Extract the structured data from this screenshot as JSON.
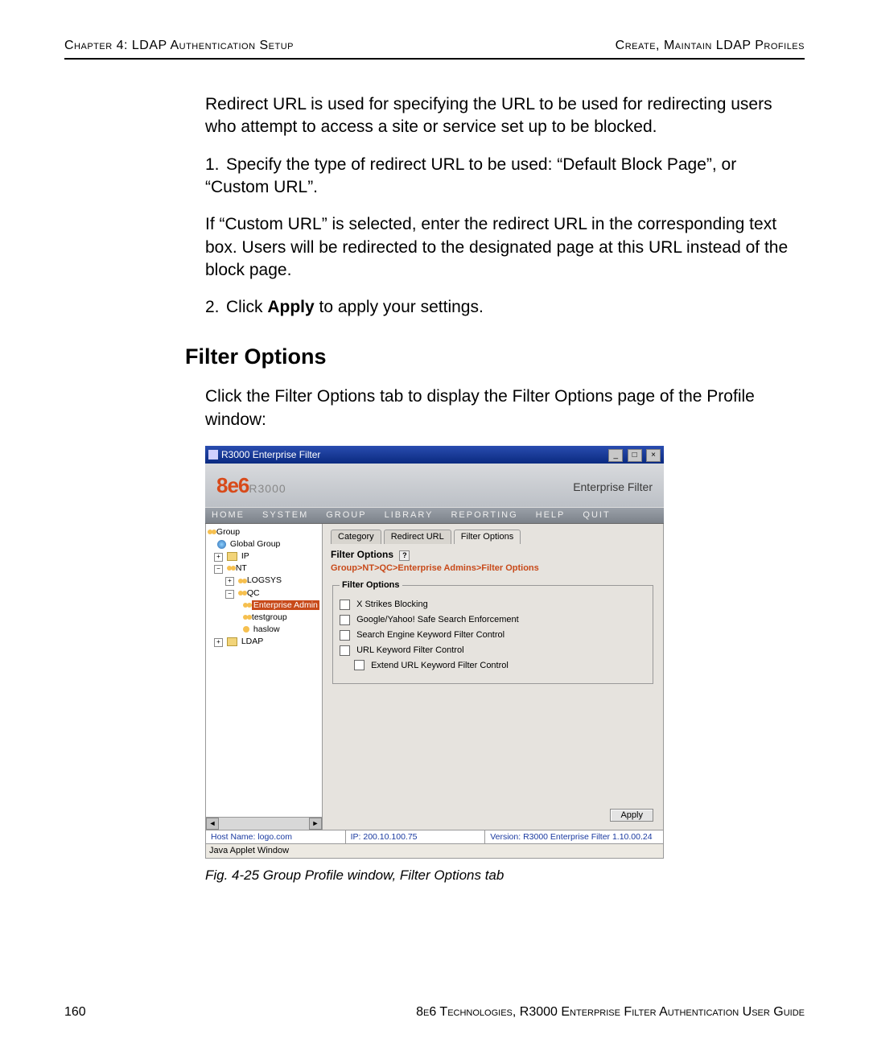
{
  "header": {
    "left": "Chapter 4: LDAP Authentication Setup",
    "right": "Create, Maintain LDAP Profiles"
  },
  "body": {
    "intro": "Redirect URL is used for specifying the URL to be used for redirecting users who attempt to access a site or service set up to be blocked.",
    "step1": "Specify the type of redirect URL to be used: “Default Block Page”, or “Custom URL”.",
    "step1_note": "If “Custom URL” is selected, enter the redirect URL in the corresponding text box. Users will be redirected to the designated page at this URL instead of the block page.",
    "step2_pre": "Click ",
    "step2_bold": "Apply",
    "step2_post": " to apply your settings.",
    "h2": "Filter Options",
    "after_h2": "Click the Filter Options tab to display the Filter Options page of the Profile window:"
  },
  "window": {
    "title": "R3000 Enterprise Filter",
    "logo_main": "8e6",
    "logo_sub": "R3000",
    "banner_right": "Enterprise Filter",
    "menus": [
      "HOME",
      "SYSTEM",
      "GROUP",
      "LIBRARY",
      "REPORTING",
      "HELP",
      "QUIT"
    ],
    "tree": {
      "root": "Group",
      "global": "Global Group",
      "ip": "IP",
      "nt": "NT",
      "logsys": "LOGSYS",
      "qc": "QC",
      "ent_admin": "Enterprise Admin",
      "testgroup": "testgroup",
      "haslow": "haslow",
      "ldap": "LDAP"
    },
    "tabs": [
      "Category",
      "Redirect URL",
      "Filter Options"
    ],
    "pane_title": "Filter Options",
    "breadcrumb": "Group>NT>QC>Enterprise Admins>Filter Options",
    "fieldset_legend": "Filter Options",
    "checks": {
      "xstrikes": "X Strikes Blocking",
      "safesearch": "Google/Yahoo! Safe Search Enforcement",
      "se_kw": "Search Engine Keyword Filter Control",
      "url_kw": "URL Keyword Filter Control",
      "extend_url_kw": "Extend URL Keyword Filter Control"
    },
    "apply": "Apply",
    "status": {
      "host": "Host Name: logo.com",
      "ip": "IP: 200.10.100.75",
      "version": "Version: R3000 Enterprise Filter 1.10.00.24"
    },
    "java_line": "Java Applet Window"
  },
  "caption": "Fig. 4-25  Group Profile window, Filter Options tab",
  "footer": {
    "page": "160",
    "right": "8e6 Technologies, R3000 Enterprise Filter Authentication User Guide"
  }
}
